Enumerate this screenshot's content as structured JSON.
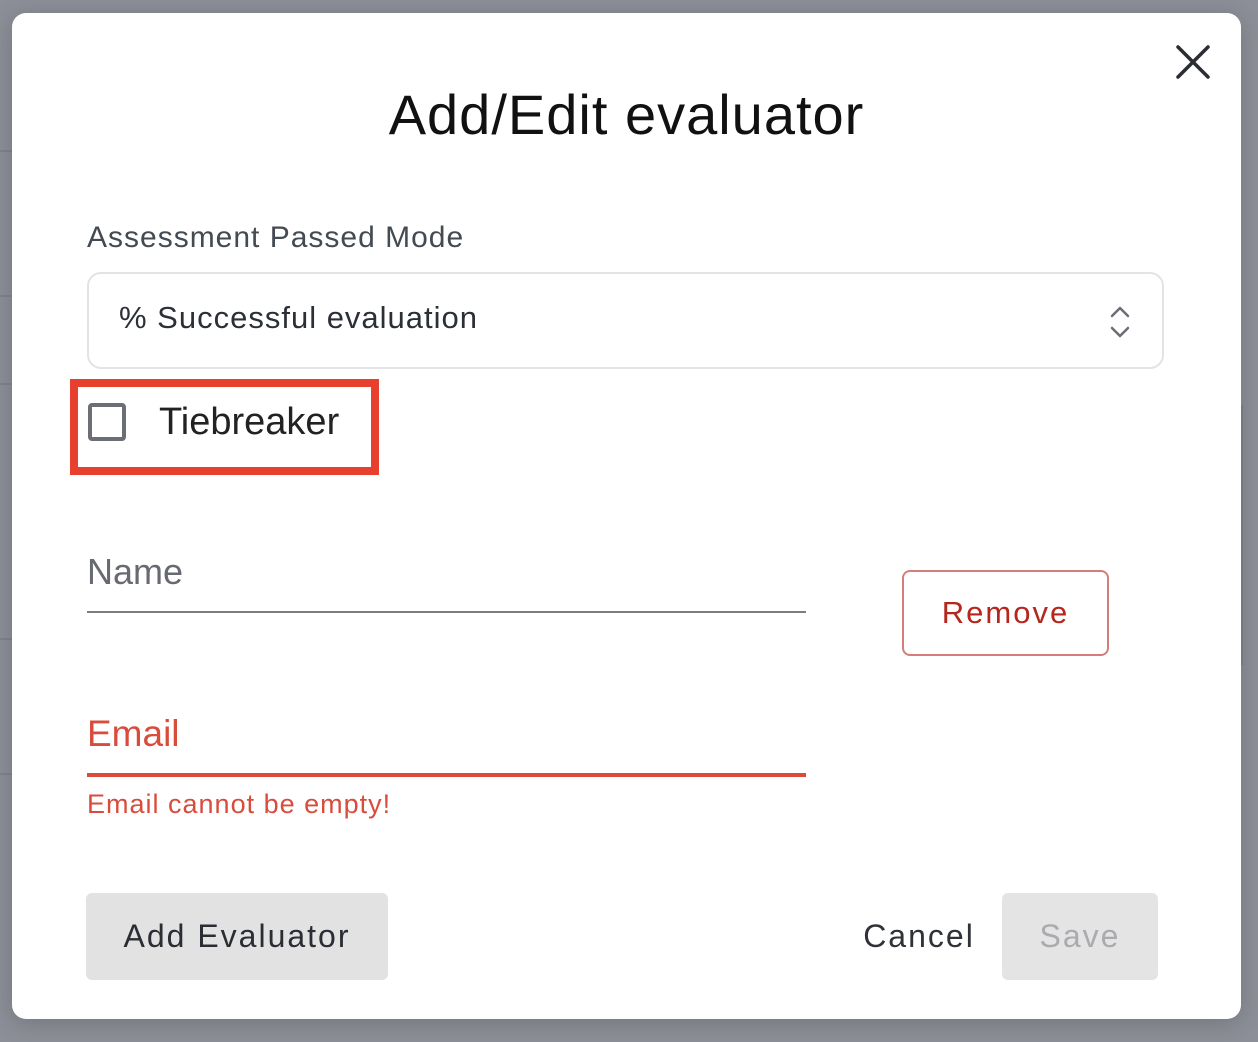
{
  "modal": {
    "title": "Add/Edit evaluator",
    "close_icon": "close-icon"
  },
  "assessment_mode": {
    "label": "Assessment Passed Mode",
    "selected_value": "% Successful evaluation",
    "arrows_icon": "chevron-up-down-icon"
  },
  "tiebreaker": {
    "label": "Tiebreaker",
    "checked": false
  },
  "evaluator": {
    "name_label": "Name",
    "name_value": "",
    "email_label": "Email",
    "email_value": "",
    "email_error": "Email cannot be empty!",
    "remove_label": "Remove"
  },
  "footer": {
    "add_label": "Add Evaluator",
    "cancel_label": "Cancel",
    "save_label": "Save",
    "save_disabled": true
  },
  "colors": {
    "error": "#d94c3c",
    "highlight": "#e8402e",
    "remove_text": "#b5261c",
    "backdrop": "#8c8f97"
  }
}
